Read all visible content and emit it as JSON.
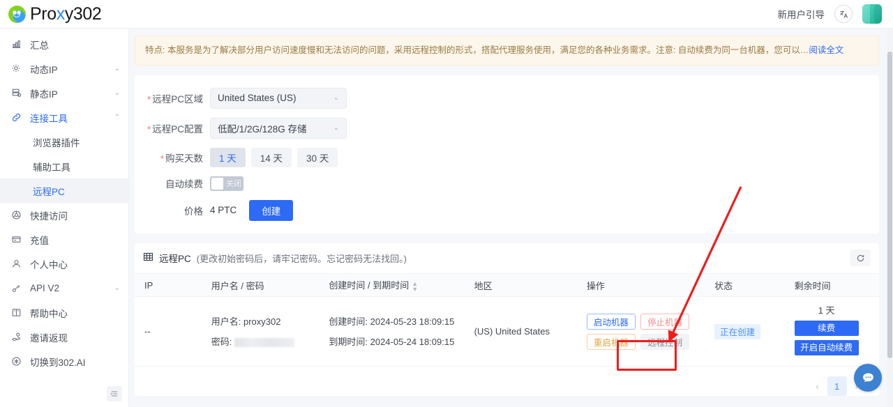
{
  "brand": {
    "name_before": "Pro",
    "name_x": "x",
    "name_after": "y302",
    "logo_icon": "proxy302-logo-icon"
  },
  "header": {
    "guide_label": "新用户引导",
    "lang_icon": "translate-icon",
    "avatar_label": "user-avatar"
  },
  "sidebar": {
    "items": [
      {
        "label": "汇总",
        "icon": "chart-bar-icon",
        "caret": "",
        "state": ""
      },
      {
        "label": "动态IP",
        "icon": "gear-ip-icon",
        "caret": "⌄",
        "state": ""
      },
      {
        "label": "静态IP",
        "icon": "server-icon",
        "caret": "⌄",
        "state": ""
      },
      {
        "label": "连接工具",
        "icon": "link-icon",
        "caret": "⌃",
        "state": "active"
      },
      {
        "label": "快捷访问",
        "icon": "globe-icon",
        "caret": "",
        "state": ""
      },
      {
        "label": "充值",
        "icon": "wallet-icon",
        "caret": "",
        "state": ""
      },
      {
        "label": "个人中心",
        "icon": "user-icon",
        "caret": "",
        "state": ""
      },
      {
        "label": "API V2",
        "icon": "api-key-icon",
        "caret": "⌄",
        "state": ""
      },
      {
        "label": "帮助中心",
        "icon": "book-icon",
        "caret": "",
        "state": ""
      },
      {
        "label": "邀请返现",
        "icon": "hand-coin-icon",
        "caret": "",
        "state": ""
      },
      {
        "label": "切换到302.AI",
        "icon": "switch-icon",
        "caret": "",
        "state": ""
      }
    ],
    "sub_items": [
      {
        "label": "浏览器插件",
        "state": ""
      },
      {
        "label": "辅助工具",
        "state": ""
      },
      {
        "label": "远程PC",
        "state": "current"
      }
    ],
    "collapse_icon": "collapse-menu-icon"
  },
  "notice": {
    "text": "特点: 本服务是为了解决部分用户访问速度慢和无法访问的问题，采用远程控制的形式，搭配代理服务使用，满足您的各种业务需求。注意: 自动续费为同一台机器，您可以…",
    "link": "阅读全文"
  },
  "form": {
    "region": {
      "label": "远程PC区域",
      "value": "United States (US)",
      "caret": "⌄",
      "required": true
    },
    "spec": {
      "label": "远程PC配置",
      "value": "低配/1/2G/128G 存储",
      "caret": "⌄",
      "required": true
    },
    "days": {
      "label": "购买天数",
      "required": true,
      "options": [
        {
          "label": "1 天",
          "selected": true
        },
        {
          "label": "14 天",
          "selected": false
        },
        {
          "label": "30 天",
          "selected": false
        }
      ]
    },
    "autorenew": {
      "label": "自动续费",
      "state_label": "关闭",
      "on": false
    },
    "price": {
      "label": "价格",
      "value": "4 PTC",
      "create_button": "创建"
    }
  },
  "table": {
    "title": "远程PC",
    "title_note": "(更改初始密码后，请牢记密码。忘记密码无法找回。)",
    "table_icon": "table-grid-icon",
    "refresh_icon": "refresh-icon",
    "columns": [
      "IP",
      "用户名 / 密码",
      "创建时间 / 到期时间",
      "地区",
      "操作",
      "状态",
      "剩余时间"
    ],
    "sort_column_index": 2,
    "rows": [
      {
        "ip": "--",
        "username_line": "用户名: proxy302",
        "password_label": "密码:",
        "password_value": "",
        "created_line": "创建时间: 2024-05-23 18:09:15",
        "expire_line": "到期时间: 2024-05-24 18:09:15",
        "region": "(US) United States",
        "ops": [
          {
            "label": "启动机器",
            "style": "op-blue"
          },
          {
            "label": "停止机器",
            "style": "op-red"
          },
          {
            "label": "重启机器",
            "style": "op-orange"
          },
          {
            "label": "远程控制",
            "style": "op-gray",
            "highlighted": true
          }
        ],
        "status": "正在创建",
        "remaining": "1 天",
        "renew_button": "续费",
        "autorenew_button": "开启自动续费"
      }
    ]
  },
  "pagination": {
    "prev": "‹",
    "next": "›",
    "current": "1"
  },
  "fab": {
    "icon": "chat-bubble-icon"
  },
  "annotation": {
    "arrow_color": "#f01c1c",
    "highlight_color": "#f01c1c",
    "target": "远程控制"
  },
  "colors": {
    "primary": "#2d6af5",
    "notice_bg": "#fdf6ec",
    "status_bg": "#e8f2fe",
    "danger": "#f01c1c"
  }
}
